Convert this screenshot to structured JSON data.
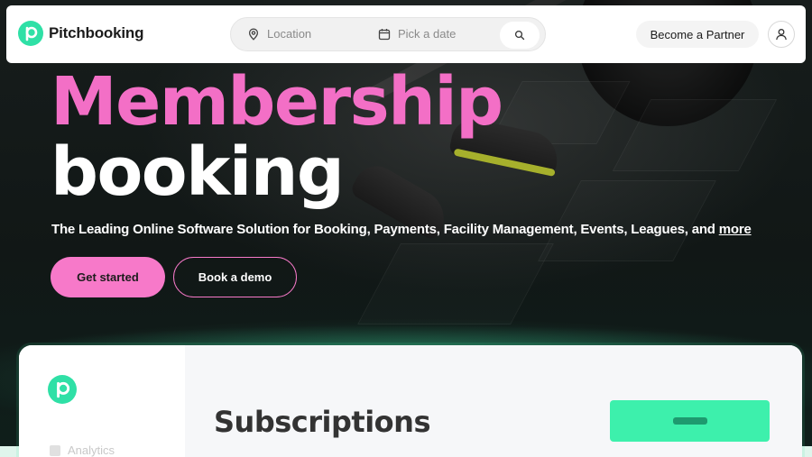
{
  "navbar": {
    "brand_name": "Pitchbooking",
    "search": {
      "location_placeholder": "Location",
      "date_placeholder": "Pick a date"
    },
    "partner_label": "Become a Partner"
  },
  "hero": {
    "headline_line1": "Membership",
    "headline_line2": "booking",
    "tagline": "The Leading Online Software Solution for Booking, Payments, Facility Management, Events, Leagues, and ",
    "tagline_link": "more",
    "cta_primary": "Get started",
    "cta_secondary": "Book a demo"
  },
  "preview": {
    "sidebar_item": "Analytics",
    "title": "Subscriptions"
  },
  "colors": {
    "brand_green": "#2fe0a6",
    "accent_pink": "#f36fc6",
    "action_green": "#3df0ac"
  },
  "icons": {
    "location": "location-pin-icon",
    "date": "calendar-icon",
    "search": "search-icon",
    "user": "user-icon"
  }
}
